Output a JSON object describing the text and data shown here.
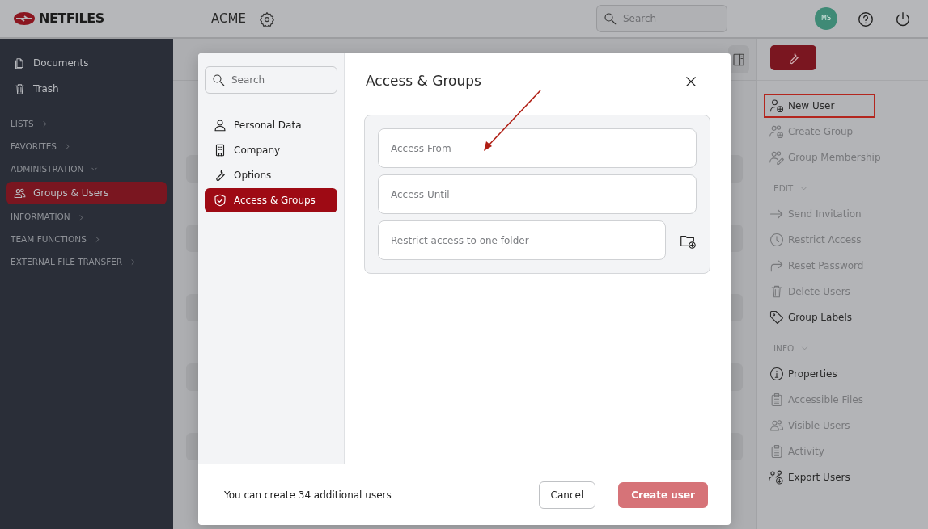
{
  "topbar": {
    "brand": "NETFILES",
    "workspace": "ACME",
    "search": {
      "placeholder": "Search"
    },
    "avatar": "MS"
  },
  "sidebar": {
    "items": [
      {
        "kind": "link",
        "label": "Documents",
        "selected": false
      },
      {
        "kind": "link",
        "label": "Trash",
        "selected": false
      },
      {
        "kind": "section",
        "label": "LISTS",
        "expanded": false
      },
      {
        "kind": "section",
        "label": "FAVORITES",
        "expanded": false
      },
      {
        "kind": "section",
        "label": "ADMINISTRATION",
        "expanded": true
      },
      {
        "kind": "link",
        "label": "Groups & Users",
        "selected": true
      },
      {
        "kind": "section",
        "label": "INFORMATION",
        "expanded": false
      },
      {
        "kind": "section",
        "label": "TEAM FUNCTIONS",
        "expanded": false
      },
      {
        "kind": "section",
        "label": "EXTERNAL FILE TRANSFER",
        "expanded": false
      }
    ]
  },
  "actions": {
    "items": [
      {
        "kind": "action",
        "label": "New User",
        "disabled": false,
        "highlighted": true
      },
      {
        "kind": "action",
        "label": "Create Group",
        "disabled": true,
        "highlighted": false
      },
      {
        "kind": "action",
        "label": "Group Membership",
        "disabled": true,
        "highlighted": false
      },
      {
        "kind": "section",
        "label": "EDIT",
        "expanded": true
      },
      {
        "kind": "action",
        "label": "Send Invitation",
        "disabled": true,
        "highlighted": false
      },
      {
        "kind": "action",
        "label": "Restrict Access",
        "disabled": true,
        "highlighted": false
      },
      {
        "kind": "action",
        "label": "Reset Password",
        "disabled": true,
        "highlighted": false
      },
      {
        "kind": "action",
        "label": "Delete Users",
        "disabled": true,
        "highlighted": false
      },
      {
        "kind": "action",
        "label": "Group Labels",
        "disabled": false,
        "highlighted": false
      },
      {
        "kind": "section",
        "label": "INFO",
        "expanded": true
      },
      {
        "kind": "action",
        "label": "Properties",
        "disabled": false,
        "highlighted": false
      },
      {
        "kind": "action",
        "label": "Accessible Files",
        "disabled": true,
        "highlighted": false
      },
      {
        "kind": "action",
        "label": "Visible Users",
        "disabled": true,
        "highlighted": false
      },
      {
        "kind": "action",
        "label": "Activity",
        "disabled": true,
        "highlighted": false
      },
      {
        "kind": "action",
        "label": "Export Users",
        "disabled": false,
        "highlighted": false
      }
    ]
  },
  "dialog": {
    "search": {
      "placeholder": "Search"
    },
    "nav": [
      {
        "label": "Personal Data",
        "selected": false
      },
      {
        "label": "Company",
        "selected": false
      },
      {
        "label": "Options",
        "selected": false
      },
      {
        "label": "Access & Groups",
        "selected": true
      }
    ],
    "title": "Access & Groups",
    "fields": [
      {
        "placeholder": "Access From"
      },
      {
        "placeholder": "Access Until"
      },
      {
        "placeholder": "Restrict access to one folder"
      }
    ],
    "footer_note": "You can create 34 additional users",
    "buttons": [
      {
        "label": "Cancel",
        "kind": "secondary"
      },
      {
        "label": "Create user",
        "kind": "primary",
        "disabled": true
      }
    ]
  }
}
